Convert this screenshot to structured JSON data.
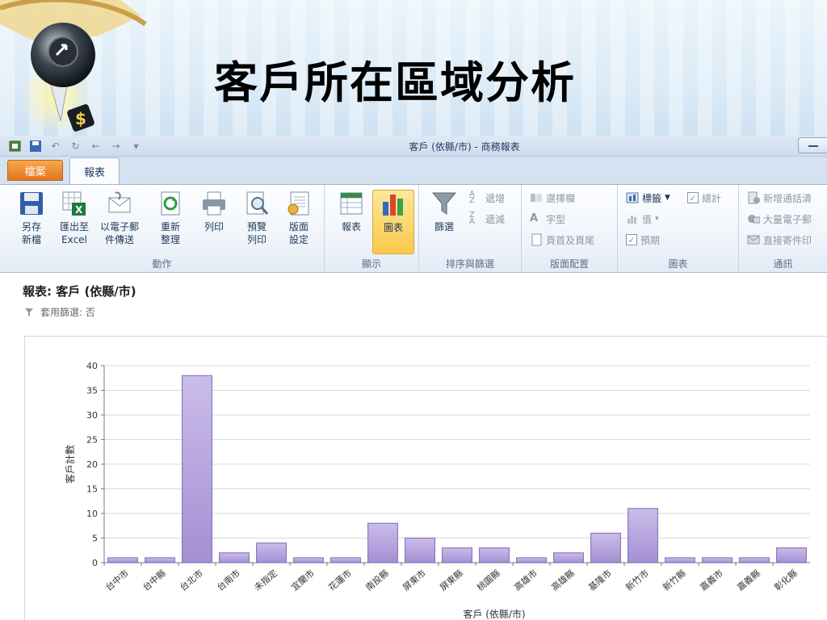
{
  "slide": {
    "title": "客戶所在區域分析"
  },
  "window": {
    "title": "客戶 (依縣/市) - 商務報表"
  },
  "tabs": {
    "file": "檔案",
    "report": "報表"
  },
  "ribbon": {
    "actions": {
      "label": "動作",
      "save_new": [
        "另存",
        "新檔"
      ],
      "export_excel": [
        "匯出至",
        "Excel"
      ],
      "email": [
        "以電子郵",
        "件傳送"
      ],
      "refresh": [
        "重新",
        "整理"
      ],
      "print": [
        "列印"
      ],
      "preview": [
        "預覽",
        "列印"
      ],
      "page_setup": [
        "版面",
        "設定"
      ]
    },
    "display": {
      "label": "顯示",
      "report": "報表",
      "chart": "圖表"
    },
    "sort_filter": {
      "label": "排序與篩選",
      "filter": "篩選",
      "asc": "遞增",
      "desc": "遞減"
    },
    "layout": {
      "label": "版面配置",
      "select_pane": "選擇欄",
      "font": "字型",
      "header_footer": "頁首及頁尾"
    },
    "chart": {
      "label": "圖表",
      "labels": "標籤",
      "total": "總計",
      "values": "值",
      "forecast": "預期"
    },
    "comms": {
      "label": "通訊",
      "new_call": "新增通話清",
      "bulk_email": "大量電子郵",
      "direct_mail": "直接寄件印"
    }
  },
  "report": {
    "heading": "報表: 客戶 (依縣/市)",
    "filter_note": "套用篩選: 否"
  },
  "chart_data": {
    "type": "bar",
    "categories": [
      "台中市",
      "台中縣",
      "台北市",
      "台南市",
      "未指定",
      "宜蘭市",
      "花蓮市",
      "南投縣",
      "屏東市",
      "屏東縣",
      "桃園縣",
      "高雄市",
      "高雄縣",
      "基隆市",
      "新竹市",
      "新竹縣",
      "嘉義市",
      "嘉義縣",
      "彰化縣"
    ],
    "values": [
      1,
      1,
      38,
      2,
      4,
      1,
      1,
      8,
      5,
      3,
      3,
      1,
      2,
      6,
      11,
      1,
      1,
      1,
      3
    ],
    "xlabel": "客戶 (依縣/市)",
    "ylabel": "客戶計數",
    "ylim": [
      0,
      40
    ],
    "yticks": [
      0,
      5,
      10,
      15,
      20,
      25,
      30,
      35,
      40
    ],
    "grid": true,
    "bar_color": "#a48fd3"
  }
}
